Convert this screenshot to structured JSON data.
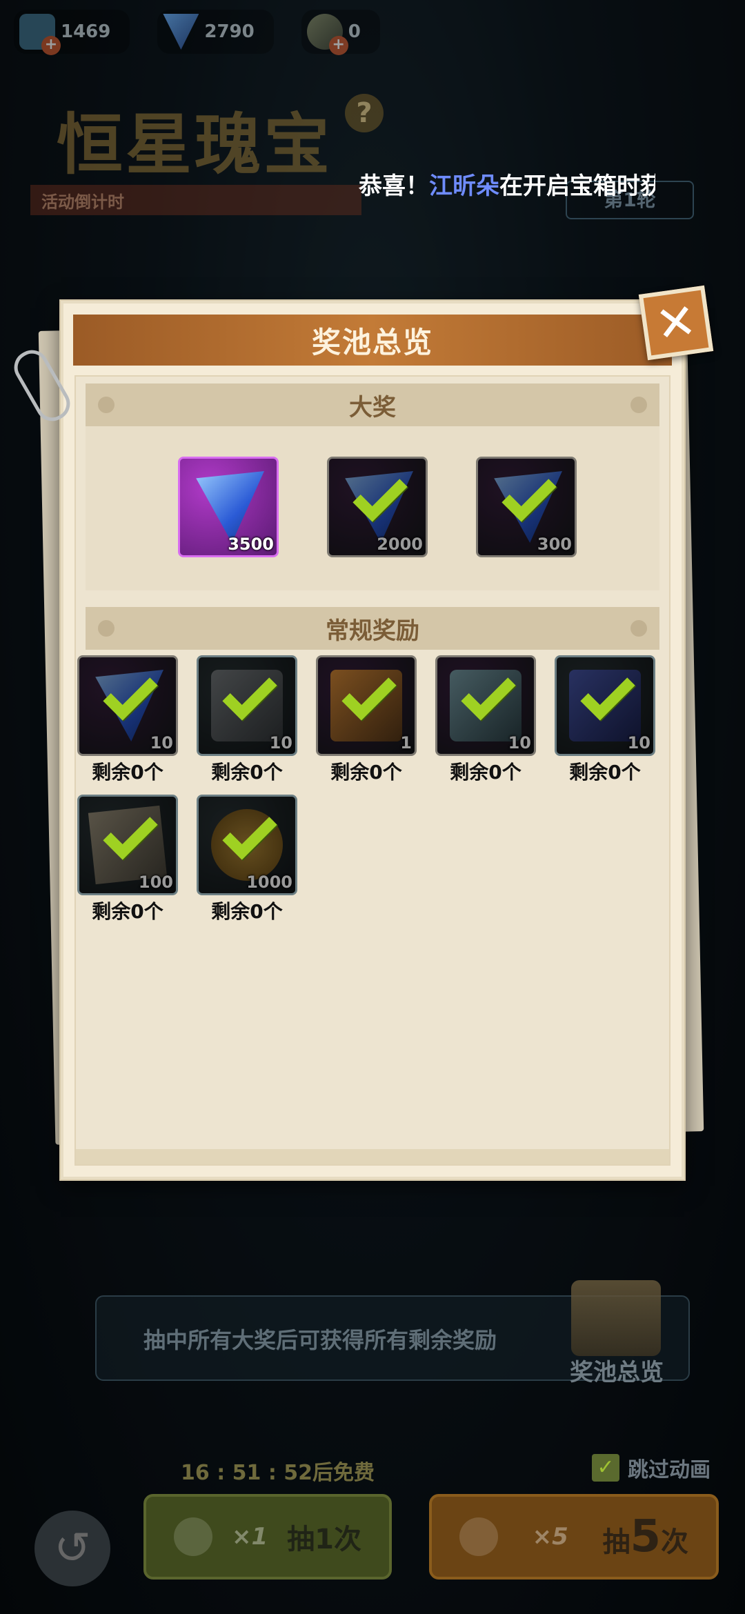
{
  "currencies": [
    {
      "icon": "crystal-icon",
      "value": "1469"
    },
    {
      "icon": "gem-icon",
      "value": "2790"
    },
    {
      "icon": "torch-icon",
      "value": "0"
    }
  ],
  "event": {
    "title": "恒星瑰宝",
    "help": "?",
    "countdown_label": "活动倒计时",
    "round_label": "第1轮"
  },
  "marquee": {
    "prefix": "恭喜！",
    "name": "江昕朵",
    "suffix": "在开启宝箱时获"
  },
  "modal": {
    "title": "奖池总览",
    "close": "✕",
    "grand_section": "大奖",
    "regular_section": "常规奖励",
    "grand_prizes": [
      {
        "icon": "gem-icon",
        "count": "3500",
        "claimed": false
      },
      {
        "icon": "gem-icon",
        "count": "2000",
        "claimed": true
      },
      {
        "icon": "gem-icon",
        "count": "300",
        "claimed": true
      }
    ],
    "regular_rewards": [
      {
        "icon": "gem-icon",
        "count": "10",
        "remain": "剩余0个",
        "claimed": true
      },
      {
        "icon": "material-box-icon",
        "count": "10",
        "remain": "剩余0个",
        "claimed": true
      },
      {
        "icon": "puzzle-piece-icon",
        "count": "1",
        "remain": "剩余0个",
        "claimed": true
      },
      {
        "icon": "device-icon",
        "count": "10",
        "remain": "剩余0个",
        "claimed": true
      },
      {
        "icon": "blue-card-icon",
        "count": "10",
        "remain": "剩余0个",
        "claimed": true
      },
      {
        "icon": "map-icon",
        "count": "100",
        "remain": "剩余0个",
        "claimed": true
      },
      {
        "icon": "coin-icon",
        "count": "1000",
        "remain": "剩余0个",
        "claimed": true
      }
    ]
  },
  "bottom": {
    "hint": "抽中所有大奖后可获得所有剩余奖励",
    "pool_overview": "奖池总览",
    "free_timer": "16 : 51 : 52后免费",
    "skip_animation": "跳过动画",
    "draw_one_mult": "×1",
    "draw_one_label": "抽1次",
    "draw_five_mult": "×5",
    "draw_five_label_a": "抽",
    "draw_five_label_b": "5",
    "draw_five_label_c": "次"
  },
  "colors": {
    "header": "#c37b37",
    "check": "#9fd122",
    "highlight_name": "#6f8cff"
  }
}
